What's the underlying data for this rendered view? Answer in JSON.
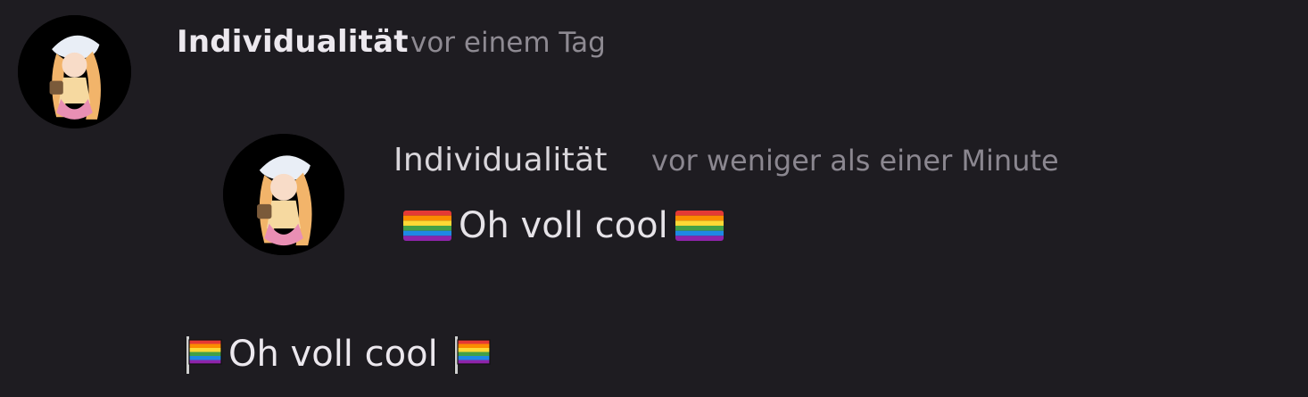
{
  "post": {
    "author": "Individualität",
    "timestamp": "vor einem Tag",
    "text": "Oh voll cool",
    "avatar_icon": "avatar-anime-girl-icon"
  },
  "quote": {
    "author": "Individualität",
    "timestamp": "vor weniger als einer Minute",
    "text": "Oh voll cool",
    "avatar_icon": "avatar-anime-girl-icon"
  },
  "emoji": {
    "flag": "rainbow-flag-icon"
  },
  "colors": {
    "background": "#1e1c21",
    "author_text": "#ece8ee",
    "timestamp_text": "#8e8a92"
  }
}
